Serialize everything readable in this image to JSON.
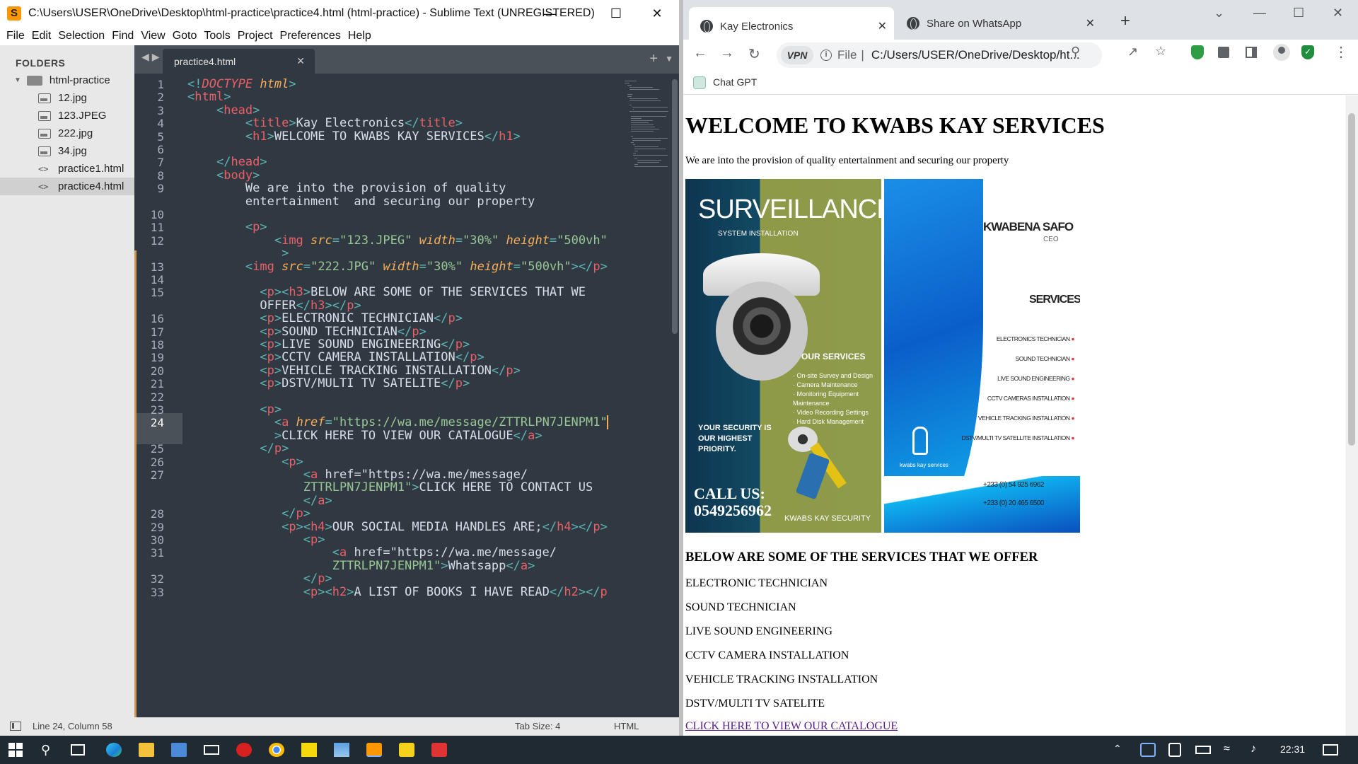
{
  "sublime": {
    "title": "C:\\Users\\USER\\OneDrive\\Desktop\\html-practice\\practice4.html (html-practice) - Sublime Text (UNREGISTERED)",
    "menu": [
      "File",
      "Edit",
      "Selection",
      "Find",
      "View",
      "Goto",
      "Tools",
      "Project",
      "Preferences",
      "Help"
    ],
    "sidebar": {
      "heading": "FOLDERS",
      "folder": "html-practice",
      "files": [
        "12.jpg",
        "123.JPEG",
        "222.jpg",
        "34.jpg",
        "practice1.html",
        "practice4.html"
      ],
      "active_file": "practice4.html"
    },
    "tab": {
      "label": "practice4.html"
    },
    "status": {
      "position": "Line 24, Column 58",
      "tab_size": "Tab Size: 4",
      "syntax": "HTML"
    }
  },
  "code_lines": [
    {
      "n": "1",
      "t": "<!DOCTYPE html>"
    },
    {
      "n": "2",
      "t": "<html>"
    },
    {
      "n": "3",
      "t": "    <head>"
    },
    {
      "n": "4",
      "t": "        <title>Kay Electronics</title>"
    },
    {
      "n": "5",
      "t": "        <h1>WELCOME TO KWABS KAY SERVICES</h1>"
    },
    {
      "n": "6",
      "t": ""
    },
    {
      "n": "7",
      "t": "    </head>"
    },
    {
      "n": "8",
      "t": "    <body>"
    },
    {
      "n": "9",
      "t": "        We are into the provision of quality"
    },
    {
      "n": "",
      "t": "        entertainment  and securing our property"
    },
    {
      "n": "10",
      "t": ""
    },
    {
      "n": "11",
      "t": "        <p>"
    },
    {
      "n": "12",
      "t": "            <img src=\"123.JPEG\" width=\"30%\" height=\"500vh\""
    },
    {
      "n": "",
      "t": "             >"
    },
    {
      "n": "13",
      "t": "        <img src=\"222.JPG\" width=\"30%\" height=\"500vh\"></p>"
    },
    {
      "n": "14",
      "t": ""
    },
    {
      "n": "15",
      "t": "          <p><h3>BELOW ARE SOME OF THE SERVICES THAT WE"
    },
    {
      "n": "",
      "t": "          OFFER</h3></p>"
    },
    {
      "n": "16",
      "t": "          <p>ELECTRONIC TECHNICIAN</p>"
    },
    {
      "n": "17",
      "t": "          <p>SOUND TECHNICIAN</p>"
    },
    {
      "n": "18",
      "t": "          <p>LIVE SOUND ENGINEERING</p>"
    },
    {
      "n": "19",
      "t": "          <p>CCTV CAMERA INSTALLATION</p>"
    },
    {
      "n": "20",
      "t": "          <p>VEHICLE TRACKING INSTALLATION</p>"
    },
    {
      "n": "21",
      "t": "          <p>DSTV/MULTI TV SATELITE</p>"
    },
    {
      "n": "22",
      "t": ""
    },
    {
      "n": "23",
      "t": "          <p>"
    },
    {
      "n": "24",
      "t": "            <a href=\"https://wa.me/message/ZTTRLPN7JENPM1\""
    },
    {
      "n": "",
      "t": "            >CLICK HERE TO VIEW OUR CATALOGUE</a>"
    },
    {
      "n": "25",
      "t": "          </p>"
    },
    {
      "n": "26",
      "t": "             <p>"
    },
    {
      "n": "27",
      "t": "                <a href=\"https://wa.me/message/"
    },
    {
      "n": "",
      "t": "                ZTTRLPN7JENPM1\">CLICK HERE TO CONTACT US"
    },
    {
      "n": "",
      "t": "                </a>"
    },
    {
      "n": "28",
      "t": "             </p>"
    },
    {
      "n": "29",
      "t": "             <p><h4>OUR SOCIAL MEDIA HANDLES ARE;</h4></p>"
    },
    {
      "n": "30",
      "t": "                <p>"
    },
    {
      "n": "31",
      "t": "                    <a href=\"https://wa.me/message/"
    },
    {
      "n": "",
      "t": "                    ZTTRLPN7JENPM1\">Whatsapp</a>"
    },
    {
      "n": "32",
      "t": "                </p>"
    },
    {
      "n": "33",
      "t": "                <p><h2>A LIST OF BOOKS I HAVE READ</h2></p"
    }
  ],
  "chrome": {
    "tabs": [
      "Kay Electronics",
      "Share on WhatsApp"
    ],
    "omnibox": {
      "vpn": "VPN",
      "scheme_label": "File",
      "url": "C:/Users/USER/OneDrive/Desktop/ht..."
    },
    "bookmark": "Chat GPT"
  },
  "page": {
    "heading": "WELCOME TO KWABS KAY SERVICES",
    "intro": "We are into the provision of quality entertainment and securing our property",
    "image1": {
      "title": "SURVEILLANCE",
      "subtitle": "System Installation",
      "services_heading": "OUR SERVICES",
      "services": [
        "On-site Survey and Design",
        "Camera Maintenance",
        "Monitoring Equipment Maintenance",
        "Video Recording Settings",
        "Hard Disk Management"
      ],
      "tagline": "YOUR SECURITY IS OUR HIGHEST PRIORITY.",
      "call_label": "CALL US:",
      "phone": "0549256962",
      "brand": "KWABS KAY SECURITY"
    },
    "image2": {
      "name": "KWABENA SAFO",
      "role": "CEO",
      "services_heading": "SERVICES",
      "services": [
        "ELECTRONICS TECHNICIAN",
        "SOUND TECHNICIAN",
        "LIVE SOUND ENGINEERING",
        "CCTV CAMERAS INSTALLATION",
        "VEHICLE TRACKING INSTALLATION",
        "DSTV/MULTI TV SATELLITE INSTALLATION"
      ],
      "logo_text": "kwabs kay services",
      "phones": [
        "+233 (0) 54 925 6962",
        "+233 (0) 20 465 6500"
      ]
    },
    "services_heading": "BELOW ARE SOME OF THE SERVICES THAT WE OFFER",
    "services": [
      "ELECTRONIC TECHNICIAN",
      "SOUND TECHNICIAN",
      "LIVE SOUND ENGINEERING",
      "CCTV CAMERA INSTALLATION",
      "VEHICLE TRACKING INSTALLATION",
      "DSTV/MULTI TV SATELITE"
    ],
    "catalogue_link": "CLICK HERE TO VIEW OUR CATALOGUE"
  },
  "taskbar": {
    "time": "22:31"
  }
}
